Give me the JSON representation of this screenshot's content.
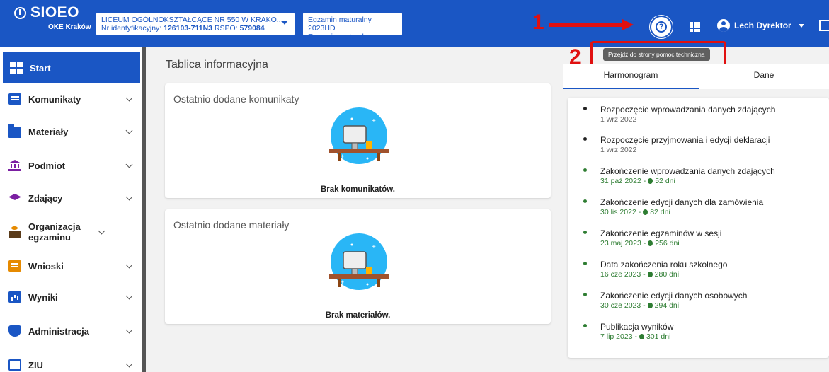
{
  "header": {
    "logo_main": "SIOEO",
    "logo_sub": "OKE Kraków",
    "school_name": "LICEUM OGÓLNOKSZTAŁCĄCE NR 550 W KRAKO...",
    "school_id_label": "Nr identyfikacyjny:",
    "school_id": "126103-711N3",
    "rspo_label": "RSPO:",
    "rspo": "579084",
    "exam_line1": "Egzamin maturalny 2023HD",
    "exam_line2": "Egzamin maturalny",
    "user_name": "Lech Dyrektor",
    "help_glyph": "?"
  },
  "annotations": {
    "label_1": "1",
    "label_2": "2",
    "tooltip": "Przejdź do strony pomoc techniczna",
    "color": "#e01010"
  },
  "sidebar": {
    "items": [
      {
        "label": "Start",
        "icon": "grid-icon"
      },
      {
        "label": "Komunikaty",
        "icon": "message-icon"
      },
      {
        "label": "Materiały",
        "icon": "folder-icon"
      },
      {
        "label": "Podmiot",
        "icon": "institution-icon"
      },
      {
        "label": "Zdający",
        "icon": "graduation-cap-icon"
      },
      {
        "label": "Organizacja egzaminu",
        "icon": "organization-icon"
      },
      {
        "label": "Wnioski",
        "icon": "document-icon"
      },
      {
        "label": "Wyniki",
        "icon": "chart-icon"
      },
      {
        "label": "Administracja",
        "icon": "shield-icon"
      },
      {
        "label": "ZIU",
        "icon": "ziu-icon"
      }
    ]
  },
  "main": {
    "title": "Tablica informacyjna",
    "cards": [
      {
        "title": "Ostatnio dodane komunikaty",
        "empty": "Brak komunikatów."
      },
      {
        "title": "Ostatnio dodane materiały",
        "empty": "Brak materiałów."
      }
    ]
  },
  "right_panel": {
    "tabs": [
      "Harmonogram",
      "Dane"
    ],
    "events": [
      {
        "title": "Rozpoczęcie wprowadzania danych zdających",
        "date": "1 wrz 2022",
        "days": ""
      },
      {
        "title": "Rozpoczęcie przyjmowania i edycji deklaracji",
        "date": "1 wrz 2022",
        "days": ""
      },
      {
        "title": "Zakończenie wprowadzania danych zdających",
        "date": "31 paź 2022 -",
        "days": "52 dni"
      },
      {
        "title": "Zakończenie edycji danych dla zamówienia",
        "date": "30 lis 2022 -",
        "days": "82 dni"
      },
      {
        "title": "Zakończenie egzaminów w sesji",
        "date": "23 maj 2023 -",
        "days": "256 dni"
      },
      {
        "title": "Data zakończenia roku szkolnego",
        "date": "16 cze 2023 -",
        "days": "280 dni"
      },
      {
        "title": "Zakończenie edycji danych osobowych",
        "date": "30 cze 2023 -",
        "days": "294 dni"
      },
      {
        "title": "Publikacja wyników",
        "date": "7 lip 2023 -",
        "days": "301 dni"
      }
    ]
  },
  "colors": {
    "brand": "#1a56c4",
    "countdown": "#2e7d32"
  }
}
